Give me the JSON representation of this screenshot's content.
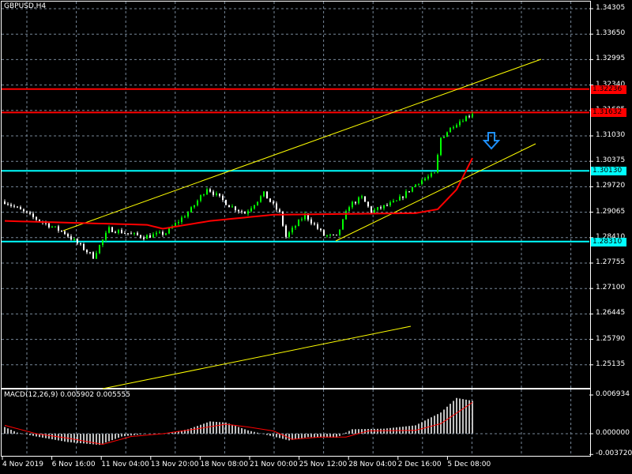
{
  "title": "GBPUSD,H4",
  "price_axis": [
    "1.34305",
    "1.33650",
    "1.32995",
    "1.32340",
    "1.31685",
    "1.31030",
    "1.30375",
    "1.29720",
    "1.29065",
    "1.28410",
    "1.27755",
    "1.27100",
    "1.26445",
    "1.25790",
    "1.25135"
  ],
  "tags": [
    {
      "value": "1.32236",
      "price": 1.32236,
      "color": "#ff0000",
      "text": "#000000"
    },
    {
      "value": "1.31632",
      "price": 1.31632,
      "color": "#ff0000",
      "text": "#000000"
    },
    {
      "value": "1.30130",
      "price": 1.3013,
      "color": "#00ffff",
      "text": "#000000"
    },
    {
      "value": "1.28310",
      "price": 1.2831,
      "color": "#00ffff",
      "text": "#000000"
    }
  ],
  "time_axis": [
    "4 Nov 2019",
    "6 Nov 16:00",
    "11 Nov 04:00",
    "13 Nov 20:00",
    "18 Nov 08:00",
    "21 Nov 00:00",
    "25 Nov 12:00",
    "28 Nov 04:00",
    "2 Dec 16:00",
    "5 Dec 08:00"
  ],
  "macd": {
    "label": "MACD(12,26,9) 0.005902 0.005555",
    "axis": [
      "0.006934",
      "0.000000",
      "-0.003720"
    ],
    "max": 0.006934,
    "min": -0.00372
  },
  "colors": {
    "bull": "#00ff00",
    "bear": "#ffffff",
    "ma": "#ff0000",
    "trend": "#ffff00",
    "support": "#00ffff",
    "resistance": "#ff0000",
    "arrow": "#1e90ff"
  },
  "chart_data": {
    "type": "candlestick",
    "symbol": "GBPUSD",
    "timeframe": "H4",
    "ylim": [
      1.2448,
      1.34305
    ],
    "price_path": [
      [
        0,
        1.2934
      ],
      [
        9,
        1.2893
      ],
      [
        19,
        1.2853
      ],
      [
        28,
        1.2792
      ],
      [
        33,
        1.2863
      ],
      [
        44,
        1.2843
      ],
      [
        51,
        1.2853
      ],
      [
        59,
        1.2914
      ],
      [
        64,
        1.2969
      ],
      [
        71,
        1.2924
      ],
      [
        76,
        1.2904
      ],
      [
        82,
        1.2954
      ],
      [
        87,
        1.2904
      ],
      [
        89,
        1.2843
      ],
      [
        95,
        1.29
      ],
      [
        101,
        1.2847
      ],
      [
        105,
        1.2843
      ],
      [
        109,
        1.2924
      ],
      [
        113,
        1.2944
      ],
      [
        116,
        1.2908
      ],
      [
        124,
        1.2934
      ],
      [
        131,
        1.2985
      ],
      [
        136,
        1.3005
      ],
      [
        138,
        1.3097
      ],
      [
        142,
        1.3131
      ],
      [
        148,
        1.3162
      ]
    ],
    "moving_average": [
      [
        0,
        1.2884
      ],
      [
        45,
        1.2874
      ],
      [
        50,
        1.2864
      ],
      [
        65,
        1.2884
      ],
      [
        85,
        1.29
      ],
      [
        130,
        1.2904
      ],
      [
        137,
        1.2914
      ],
      [
        143,
        1.2965
      ],
      [
        148,
        1.3046
      ]
    ],
    "macd_hist": [
      [
        0,
        0.0012
      ],
      [
        4,
        0.0002
      ],
      [
        10,
        -0.0005
      ],
      [
        20,
        -0.0015
      ],
      [
        30,
        -0.002
      ],
      [
        37,
        -0.0005
      ],
      [
        45,
        0.0
      ],
      [
        51,
        0.0
      ],
      [
        58,
        0.0008
      ],
      [
        65,
        0.0022
      ],
      [
        70,
        0.002
      ],
      [
        77,
        0.0006
      ],
      [
        85,
        -0.0005
      ],
      [
        90,
        -0.0012
      ],
      [
        96,
        -0.0006
      ],
      [
        105,
        -0.0007
      ],
      [
        110,
        0.0008
      ],
      [
        120,
        0.0009
      ],
      [
        130,
        0.0015
      ],
      [
        138,
        0.0038
      ],
      [
        143,
        0.0064
      ],
      [
        148,
        0.0059
      ]
    ],
    "macd_signal": [
      [
        0,
        0.0015
      ],
      [
        10,
        0.0
      ],
      [
        20,
        -0.0008
      ],
      [
        31,
        -0.0019
      ],
      [
        40,
        -0.0005
      ],
      [
        50,
        0.0
      ],
      [
        60,
        0.0008
      ],
      [
        70,
        0.0017
      ],
      [
        77,
        0.0012
      ],
      [
        85,
        0.0005
      ],
      [
        91,
        -0.001
      ],
      [
        100,
        -0.0006
      ],
      [
        108,
        -0.0006
      ],
      [
        115,
        0.0005
      ],
      [
        130,
        0.0006
      ],
      [
        138,
        0.0018
      ],
      [
        148,
        0.0056
      ]
    ]
  }
}
